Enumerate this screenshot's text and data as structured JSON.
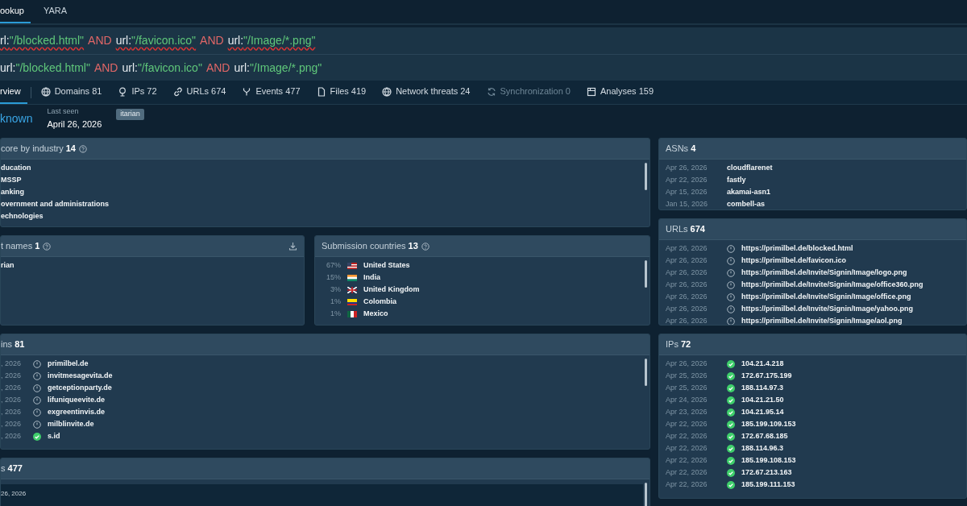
{
  "top_tabs": [
    {
      "label": "ookup",
      "selected": true
    },
    {
      "label": "YARA",
      "selected": false
    }
  ],
  "query_lines": [
    {
      "tokens": [
        {
          "text": "rl:",
          "kind": "key",
          "misspelled": true
        },
        {
          "text": "\"/blocked.html\"",
          "kind": "string",
          "misspelled": true
        },
        {
          "text": "AND",
          "kind": "op",
          "misspelled": false
        },
        {
          "text": "url:",
          "kind": "key",
          "misspelled": true
        },
        {
          "text": "\"/favicon.ico\"",
          "kind": "string",
          "misspelled": true
        },
        {
          "text": "AND",
          "kind": "op",
          "misspelled": false
        },
        {
          "text": "url:",
          "kind": "key",
          "misspelled": true
        },
        {
          "text": "\"/Image/*.png\"",
          "kind": "string",
          "misspelled": true
        }
      ]
    },
    {
      "tokens": [
        {
          "text": "url:",
          "kind": "key",
          "misspelled": false
        },
        {
          "text": "\"/blocked.html\"",
          "kind": "string",
          "misspelled": false
        },
        {
          "text": "AND",
          "kind": "op",
          "misspelled": false
        },
        {
          "text": "url:",
          "kind": "key",
          "misspelled": false
        },
        {
          "text": "\"/favicon.ico\"",
          "kind": "string",
          "misspelled": false
        },
        {
          "text": "AND",
          "kind": "op",
          "misspelled": false
        },
        {
          "text": "url:",
          "kind": "key",
          "misspelled": false
        },
        {
          "text": "\"/Image/*.png\"",
          "kind": "string",
          "misspelled": false
        }
      ]
    }
  ],
  "section_tabs": [
    {
      "label": "rview",
      "kind": "none",
      "selected": true,
      "disabled": false
    },
    {
      "label": "Domains",
      "count": "81",
      "kind": "globe",
      "selected": false,
      "disabled": false
    },
    {
      "label": "IPs",
      "count": "72",
      "kind": "pin",
      "selected": false,
      "disabled": false
    },
    {
      "label": "URLs",
      "count": "674",
      "kind": "link",
      "selected": false,
      "disabled": false
    },
    {
      "label": "Events",
      "count": "477",
      "kind": "fork",
      "selected": false,
      "disabled": false
    },
    {
      "label": "Files",
      "count": "419",
      "kind": "file",
      "selected": false,
      "disabled": false
    },
    {
      "label": "Network threats",
      "count": "24",
      "kind": "globe",
      "selected": false,
      "disabled": false
    },
    {
      "label": "Synchronization",
      "count": "0",
      "kind": "sync",
      "selected": false,
      "disabled": true
    },
    {
      "label": "Analyses",
      "count": "159",
      "kind": "window",
      "selected": false,
      "disabled": false
    }
  ],
  "summary": {
    "verdict": "known",
    "last_seen_label": "Last seen",
    "last_seen": "April 26, 2026",
    "tag": "itarian"
  },
  "industry_panel": {
    "title": "core by industry",
    "count": "14",
    "items": [
      "ducation",
      "MSSP",
      "anking",
      "overnment and administrations",
      "echnologies"
    ]
  },
  "names_panel": {
    "title": "t names",
    "count": "1",
    "items": [
      "rian"
    ]
  },
  "countries_panel": {
    "title": "Submission countries",
    "count": "13",
    "items": [
      {
        "share": "67%",
        "name": "United States"
      },
      {
        "share": "15%",
        "name": "India"
      },
      {
        "share": "3%",
        "name": "United Kingdom"
      },
      {
        "share": "1%",
        "name": "Colombia"
      },
      {
        "share": "1%",
        "name": "Mexico"
      }
    ]
  },
  "domains_panel": {
    "title": "ins",
    "count": "81",
    "rows": [
      {
        "date": ", 2026",
        "verified": false,
        "name": "primilbel.de"
      },
      {
        "date": ", 2026",
        "verified": false,
        "name": "invitmesagevita.de"
      },
      {
        "date": ", 2026",
        "verified": false,
        "name": "getceptionparty.de"
      },
      {
        "date": ", 2026",
        "verified": false,
        "name": "lifuniqueevite.de"
      },
      {
        "date": ", 2026",
        "verified": false,
        "name": "exgreentinvis.de"
      },
      {
        "date": ", 2026",
        "verified": false,
        "name": "milblinvite.de"
      },
      {
        "date": ", 2026",
        "verified": true,
        "name": "s.id"
      }
    ]
  },
  "events_panel": {
    "title": "s",
    "count": "477",
    "first_date": "26, 2026"
  },
  "asns_panel": {
    "title": "ASNs",
    "count": "4",
    "rows": [
      {
        "date": "Apr 26, 2026",
        "name": "cloudflarenet"
      },
      {
        "date": "Apr 22, 2026",
        "name": "fastly"
      },
      {
        "date": "Apr 15, 2026",
        "name": "akamai-asn1"
      },
      {
        "date": "Jan 15, 2026",
        "name": "combell-as"
      }
    ]
  },
  "urls_panel": {
    "title": "URLs",
    "count": "674",
    "rows": [
      {
        "date": "Apr 26, 2026",
        "verified": false,
        "name": "https://primilbel.de/blocked.html"
      },
      {
        "date": "Apr 26, 2026",
        "verified": false,
        "name": "https://primilbel.de/favicon.ico"
      },
      {
        "date": "Apr 26, 2026",
        "verified": false,
        "name": "https://primilbel.de/Invite/Signin/Image/logo.png"
      },
      {
        "date": "Apr 26, 2026",
        "verified": false,
        "name": "https://primilbel.de/Invite/Signin/Image/office360.png"
      },
      {
        "date": "Apr 26, 2026",
        "verified": false,
        "name": "https://primilbel.de/Invite/Signin/Image/office.png"
      },
      {
        "date": "Apr 26, 2026",
        "verified": false,
        "name": "https://primilbel.de/Invite/Signin/Image/yahoo.png"
      },
      {
        "date": "Apr 26, 2026",
        "verified": false,
        "name": "https://primilbel.de/Invite/Signin/Image/aol.png"
      }
    ]
  },
  "ips_panel": {
    "title": "IPs",
    "count": "72",
    "rows": [
      {
        "date": "Apr 26, 2026",
        "verified": true,
        "name": "104.21.4.218"
      },
      {
        "date": "Apr 25, 2026",
        "verified": true,
        "name": "172.67.175.199"
      },
      {
        "date": "Apr 25, 2026",
        "verified": true,
        "name": "188.114.97.3"
      },
      {
        "date": "Apr 24, 2026",
        "verified": true,
        "name": "104.21.21.50"
      },
      {
        "date": "Apr 23, 2026",
        "verified": true,
        "name": "104.21.95.14"
      },
      {
        "date": "Apr 22, 2026",
        "verified": true,
        "name": "185.199.109.153"
      },
      {
        "date": "Apr 22, 2026",
        "verified": true,
        "name": "172.67.68.185"
      },
      {
        "date": "Apr 22, 2026",
        "verified": true,
        "name": "188.114.96.3"
      },
      {
        "date": "Apr 22, 2026",
        "verified": true,
        "name": "185.199.108.153"
      },
      {
        "date": "Apr 22, 2026",
        "verified": true,
        "name": "172.67.213.163"
      },
      {
        "date": "Apr 22, 2026",
        "verified": true,
        "name": "185.199.111.153"
      }
    ]
  }
}
